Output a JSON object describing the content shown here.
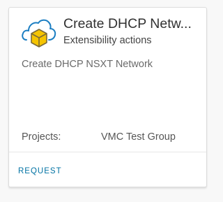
{
  "card": {
    "icon": "cloud-cube-icon",
    "title": "Create DHCP Netw...",
    "subtitle": "Extensibility actions",
    "description": "Create DHCP NSXT Network",
    "projects": {
      "label": "Projects:",
      "value": "VMC Test Group"
    },
    "request_label": "REQUEST"
  },
  "colors": {
    "accent": "#0072a3",
    "icon_outline": "#1b7ec2",
    "icon_cube": "#f5c400"
  }
}
